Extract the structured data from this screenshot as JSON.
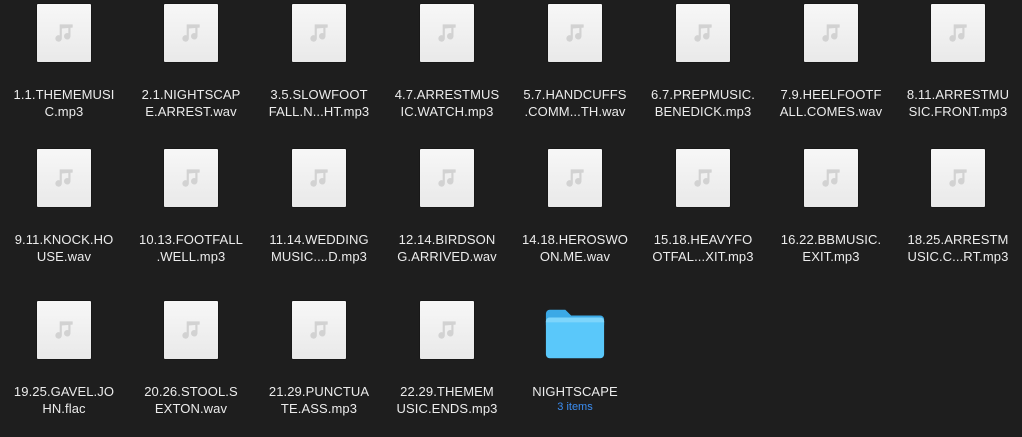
{
  "files": [
    {
      "name": "1.1.THEMEMUSI\nC.mp3",
      "icon": "music-file-icon"
    },
    {
      "name": "2.1.NIGHTSCAP\nE.ARREST.wav",
      "icon": "music-file-icon"
    },
    {
      "name": "3.5.SLOWFOOT\nFALL.N...HT.mp3",
      "icon": "music-file-icon"
    },
    {
      "name": "4.7.ARRESTMUS\nIC.WATCH.mp3",
      "icon": "music-file-icon"
    },
    {
      "name": "5.7.HANDCUFFS\n.COMM...TH.wav",
      "icon": "music-file-icon"
    },
    {
      "name": "6.7.PREPMUSIC.\nBENEDICK.mp3",
      "icon": "music-file-icon"
    },
    {
      "name": "7.9.HEELFOOTF\nALL.COMES.wav",
      "icon": "music-file-icon"
    },
    {
      "name": "8.11.ARRESTMU\nSIC.FRONT.mp3",
      "icon": "music-file-icon"
    },
    {
      "name": "9.11.KNOCK.HO\nUSE.wav",
      "icon": "music-file-icon"
    },
    {
      "name": "10.13.FOOTFALL\n.WELL.mp3",
      "icon": "music-file-icon"
    },
    {
      "name": "11.14.WEDDING\nMUSIC....D.mp3",
      "icon": "music-file-icon"
    },
    {
      "name": "12.14.BIRDSON\nG.ARRIVED.wav",
      "icon": "music-file-icon"
    },
    {
      "name": "14.18.HEROSWO\nON.ME.wav",
      "icon": "music-file-icon"
    },
    {
      "name": "15.18.HEAVYFO\nOTFAL...XIT.mp3",
      "icon": "music-file-icon"
    },
    {
      "name": "16.22.BBMUSIC.\nEXIT.mp3",
      "icon": "music-file-icon"
    },
    {
      "name": "18.25.ARRESTM\nUSIC.C...RT.mp3",
      "icon": "music-file-icon"
    },
    {
      "name": "19.25.GAVEL.JO\nHN.flac",
      "icon": "music-file-icon"
    },
    {
      "name": "20.26.STOOL.S\nEXTON.wav",
      "icon": "music-file-icon"
    },
    {
      "name": "21.29.PUNCTUA\nTE.ASS.mp3",
      "icon": "music-file-icon"
    },
    {
      "name": "22.29.THEMEM\nUSIC.ENDS.mp3",
      "icon": "music-file-icon"
    }
  ],
  "folder": {
    "name": "NIGHTSCAPE",
    "subtitle": "3 items",
    "icon": "folder-icon",
    "color": "#5ac8fa"
  },
  "colors": {
    "background": "#1e1e1e",
    "label": "#ececec",
    "sublabel": "#3b8ef3"
  }
}
